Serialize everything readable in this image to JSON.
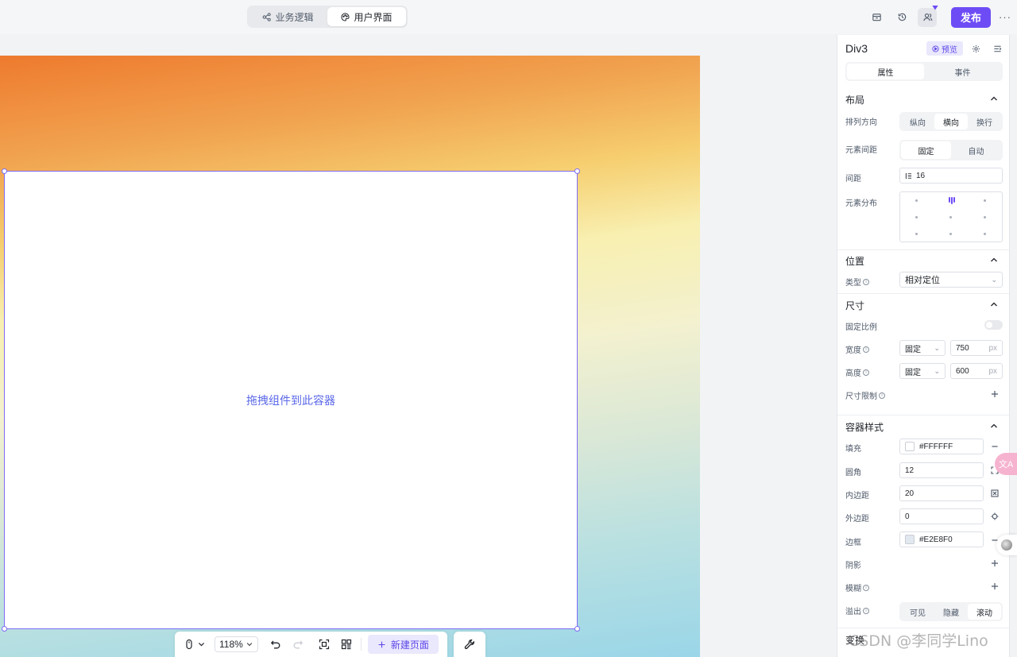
{
  "topbar": {
    "modes": [
      {
        "label": "业务逻辑",
        "icon": "logic-flow-icon",
        "active": false
      },
      {
        "label": "用户界面",
        "icon": "palette-icon",
        "active": true
      }
    ],
    "publish_label": "发布",
    "more_label": "···",
    "accent": "#6d4cf6"
  },
  "canvas": {
    "drop_hint": "拖拽组件到此容器",
    "selection_color": "#7f6cf4"
  },
  "bottom_toolbar": {
    "zoom": "118%",
    "new_page_label": "新建页面"
  },
  "panel": {
    "title": "Div3",
    "preview_label": "预览",
    "tabs": [
      "属性",
      "事件"
    ],
    "layout": {
      "title": "布局",
      "direction_label": "排列方向",
      "direction_options": [
        "纵向",
        "横向",
        "换行"
      ],
      "gap_label": "元素间距",
      "gap_options": [
        "固定",
        "自动"
      ],
      "spacing_label": "间距",
      "spacing_value": "16",
      "distribution_label": "元素分布"
    },
    "position": {
      "title": "位置",
      "type_label": "类型",
      "type_value": "相对定位"
    },
    "size": {
      "title": "尺寸",
      "ratio_label": "固定比例",
      "width_label": "宽度",
      "width_mode": "固定",
      "width_value": "750",
      "height_label": "高度",
      "height_mode": "固定",
      "height_value": "600",
      "unit": "px",
      "limit_label": "尺寸限制"
    },
    "container_style": {
      "title": "容器样式",
      "fill_label": "填充",
      "fill_value": "#FFFFFF",
      "radius_label": "圆角",
      "radius_value": "12",
      "padding_label": "内边距",
      "padding_value": "20",
      "margin_label": "外边距",
      "margin_value": "0",
      "border_label": "边框",
      "border_value": "#E2E8F0",
      "shadow_label": "阴影",
      "blur_label": "模糊",
      "overflow_label": "溢出",
      "overflow_options": [
        "可见",
        "隐藏",
        "滚动"
      ]
    },
    "transform_title": "变换"
  },
  "widgets": {
    "translate_label": "文A"
  },
  "watermark": "CSDN @李同学Lino"
}
